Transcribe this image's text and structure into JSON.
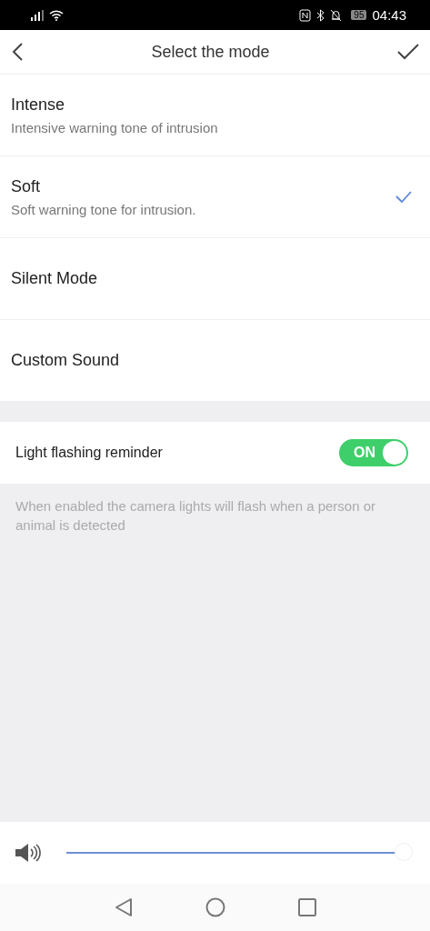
{
  "status_bar": {
    "battery": "95",
    "time": "04:43"
  },
  "header": {
    "title": "Select the mode"
  },
  "modes": [
    {
      "name": "Intense",
      "description": "Intensive warning tone of intrusion",
      "selected": false
    },
    {
      "name": "Soft",
      "description": "Soft warning tone for intrusion.",
      "selected": true
    },
    {
      "name": "Silent Mode",
      "selected": false
    },
    {
      "name": "Custom Sound",
      "selected": false
    }
  ],
  "light_reminder": {
    "label": "Light flashing reminder",
    "toggle_text": "ON",
    "on": true,
    "note": "When enabled the camera lights will flash when a person or animal is detected"
  },
  "volume": {
    "level": 1
  }
}
